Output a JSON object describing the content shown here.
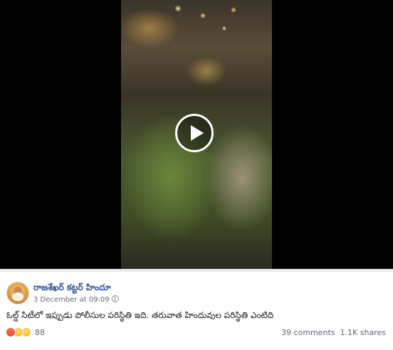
{
  "video": {
    "play_icon": "play-icon"
  },
  "post": {
    "author": "రాజశేఖర్ కట్టర్ హిందూ",
    "timestamp": "3 December at 09:09",
    "caption": "ఓల్డ్ సిటీలో ఇప్పుడు పోలీసుల పరిస్థితి ఇది. తరువాత హిందువుల పరిస్థితి ఎంటిది",
    "privacy_icon": "globe-icon"
  },
  "engagement": {
    "reaction_icons": [
      "angry-reaction-icon",
      "haha-reaction-icon",
      "sad-reaction-icon"
    ],
    "reaction_count": "88",
    "comments": "39 comments",
    "shares": "1.1K shares"
  },
  "colors": {
    "link": "#385898",
    "secondary_text": "#606770",
    "primary_text": "#1c1e21"
  }
}
